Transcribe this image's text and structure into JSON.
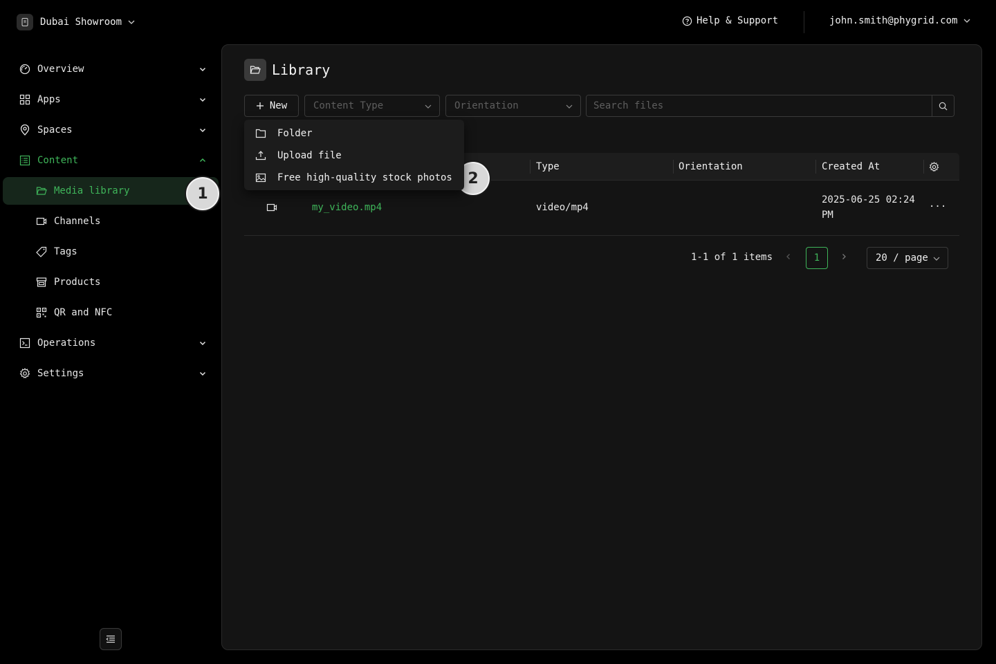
{
  "org": {
    "name": "Dubai Showroom"
  },
  "header": {
    "help_label": "Help & Support",
    "user_email": "john.smith@phygrid.com"
  },
  "sidebar": {
    "items": [
      {
        "label": "Overview"
      },
      {
        "label": "Apps"
      },
      {
        "label": "Spaces"
      },
      {
        "label": "Content"
      },
      {
        "label": "Operations"
      },
      {
        "label": "Settings"
      }
    ],
    "content_sub": [
      {
        "label": "Media library"
      },
      {
        "label": "Channels"
      },
      {
        "label": "Tags"
      },
      {
        "label": "Products"
      },
      {
        "label": "QR and NFC"
      }
    ]
  },
  "markers": {
    "m1": "1",
    "m2": "2"
  },
  "main": {
    "title": "Library",
    "new_button": "New",
    "content_type_placeholder": "Content Type",
    "orientation_placeholder": "Orientation",
    "search_placeholder": "Search files",
    "new_menu": [
      {
        "label": "Folder"
      },
      {
        "label": "Upload file"
      },
      {
        "label": "Free high-quality stock photos"
      }
    ],
    "table": {
      "columns": [
        "Type",
        "Orientation",
        "Created At"
      ],
      "rows": [
        {
          "name": "my_video.mp4",
          "type": "video/mp4",
          "orientation": "",
          "created_line1": "2025-06-25 02:24",
          "created_line2": "PM",
          "actions": "···"
        }
      ]
    },
    "pagination": {
      "summary": "1-1 of 1 items",
      "current_page": "1",
      "page_size": "20 / page"
    }
  },
  "colors": {
    "accent": "#3fb55a",
    "background": "#000000",
    "panel": "#141414"
  }
}
